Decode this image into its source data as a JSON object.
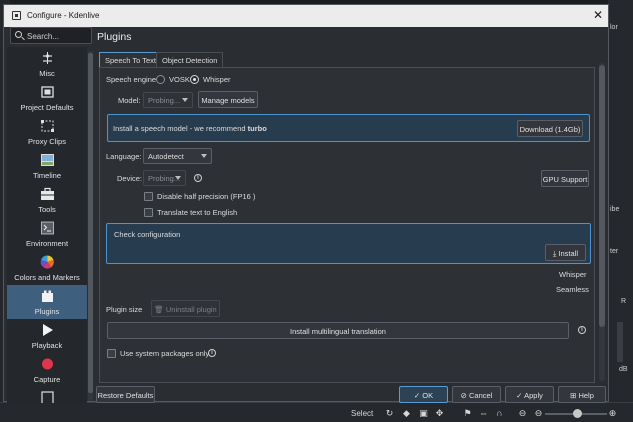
{
  "window": {
    "title": "Configure - Kdenlive",
    "close": "✕"
  },
  "search": {
    "placeholder": "Search..."
  },
  "sidebar": {
    "items": [
      {
        "label": "Misc",
        "icon": "sliders-icon"
      },
      {
        "label": "Project Defaults",
        "icon": "film-icon"
      },
      {
        "label": "Proxy Clips",
        "icon": "proxy-icon"
      },
      {
        "label": "Timeline",
        "icon": "timeline-icon"
      },
      {
        "label": "Tools",
        "icon": "toolbox-icon"
      },
      {
        "label": "Environment",
        "icon": "terminal-icon"
      },
      {
        "label": "Colors and Markers",
        "icon": "color-wheel-icon"
      },
      {
        "label": "Plugins",
        "icon": "plugin-icon"
      },
      {
        "label": "Playback",
        "icon": "play-icon"
      },
      {
        "label": "Capture",
        "icon": "record-icon"
      }
    ],
    "active": "Plugins"
  },
  "page": {
    "title": "Plugins"
  },
  "tabs": [
    {
      "label": "Speech To Text"
    },
    {
      "label": "Object Detection"
    }
  ],
  "speech": {
    "engine_label": "Speech engine",
    "engine_options": [
      "VOSK",
      "Whisper"
    ],
    "engine_selected": "Whisper",
    "model_label": "Model:",
    "model_value": "Probing...",
    "manage_models": "Manage models",
    "install_msg_prefix": "Install a speech model - we recommend ",
    "install_msg_bold": "turbo",
    "download_btn": "Download (1.4Gb)",
    "language_label": "Language:",
    "language_value": "Autodetect",
    "device_label": "Device:",
    "device_value": "Probing...",
    "gpu_support": "GPU Support",
    "fp16_label": "Disable half precision (FP16 )",
    "translate_label": "Translate text to English",
    "check_config": "Check configuration",
    "install_btn": "Install",
    "whisper_label": "Whisper",
    "seamless_label": "Seamless",
    "plugin_size_label": "Plugin size",
    "uninstall_btn": "Uninstall plugin",
    "multilingual_btn": "Install multilingual translation",
    "system_packages_label": "Use system packages only"
  },
  "footer": {
    "restore": "Restore Defaults",
    "ok": "OK",
    "cancel": "Cancel",
    "apply": "Apply",
    "help": "Help"
  },
  "background": {
    "select_label": "Select",
    "right_texts": [
      "lor",
      "ibe",
      "ter",
      "R",
      "dB"
    ]
  },
  "colors": {
    "accent": "#4c93cf",
    "selected_bg": "#3f5f7e",
    "dialog_bg": "#2a2d32"
  }
}
